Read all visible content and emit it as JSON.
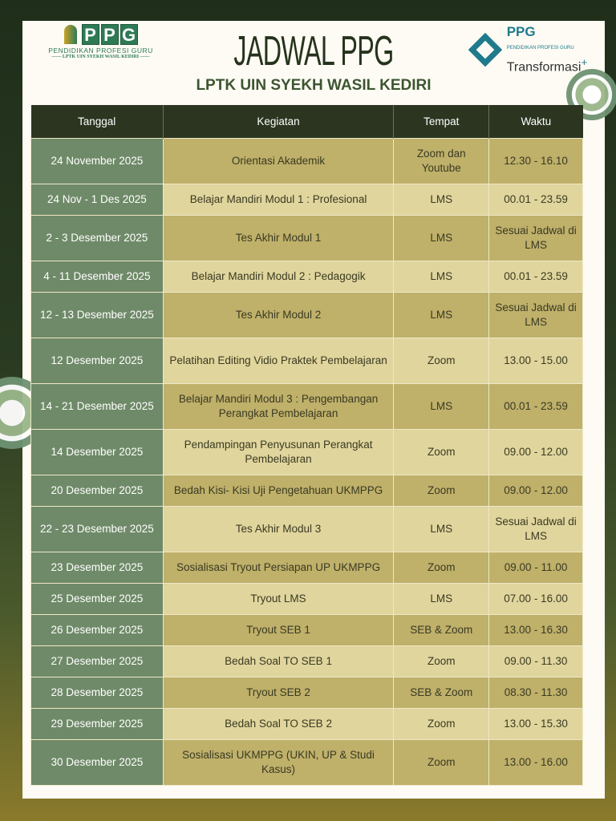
{
  "header": {
    "title": "JADWAL PPG",
    "subtitle": "LPTK UIN SYEKH WASIL KEDIRI",
    "logo_left": {
      "letters": [
        "P",
        "P",
        "G"
      ],
      "line1": "PENDIDIKAN PROFESI GURU",
      "line2": "—— LPTK UIN SYEKH WASIL KEDIRI ——"
    },
    "logo_right": {
      "brand": "PPG",
      "small": "PENDIDIKAN PROFESI GURU",
      "name": "Transformasi",
      "plus": "+"
    }
  },
  "table": {
    "columns": [
      "Tanggal",
      "Kegiatan",
      "Tempat",
      "Waktu"
    ],
    "rows": [
      {
        "tanggal": "24 November 2025",
        "kegiatan": "Orientasi Akademik",
        "tempat": "Zoom dan Youtube",
        "waktu": "12.30 - 16.10",
        "tall": true
      },
      {
        "tanggal": "24 Nov - 1 Des 2025",
        "kegiatan": "Belajar Mandiri Modul 1 : Profesional",
        "tempat": "LMS",
        "waktu": "00.01 - 23.59"
      },
      {
        "tanggal": "2 - 3 Desember 2025",
        "kegiatan": "Tes Akhir Modul 1",
        "tempat": "LMS",
        "waktu": "Sesuai Jadwal di LMS",
        "tall": true
      },
      {
        "tanggal": "4 - 11 Desember 2025",
        "kegiatan": "Belajar Mandiri Modul 2 : Pedagogik",
        "tempat": "LMS",
        "waktu": "00.01 - 23.59"
      },
      {
        "tanggal": "12 - 13 Desember 2025",
        "kegiatan": "Tes Akhir Modul 2",
        "tempat": "LMS",
        "waktu": "Sesuai Jadwal di LMS",
        "tall": true
      },
      {
        "tanggal": "12 Desember 2025",
        "kegiatan": "Pelatihan Editing Vidio Praktek Pembelajaran",
        "tempat": "Zoom",
        "waktu": "13.00 - 15.00",
        "tall": true
      },
      {
        "tanggal": "14 - 21 Desember 2025",
        "kegiatan": "Belajar Mandiri Modul 3 : Pengembangan Perangkat Pembelajaran",
        "tempat": "LMS",
        "waktu": "00.01 - 23.59",
        "tall": true
      },
      {
        "tanggal": "14 Desember 2025",
        "kegiatan": "Pendampingan Penyusunan Perangkat Pembelajaran",
        "tempat": "Zoom",
        "waktu": "09.00 - 12.00",
        "tall": true
      },
      {
        "tanggal": "20 Desember 2025",
        "kegiatan": "Bedah Kisi- Kisi Uji Pengetahuan UKMPPG",
        "tempat": "Zoom",
        "waktu": "09.00 - 12.00"
      },
      {
        "tanggal": "22 - 23 Desember 2025",
        "kegiatan": "Tes Akhir Modul 3",
        "tempat": "LMS",
        "waktu": "Sesuai Jadwal di LMS",
        "tall": true
      },
      {
        "tanggal": "23 Desember 2025",
        "kegiatan": "Sosialisasi Tryout Persiapan UP UKMPPG",
        "tempat": "Zoom",
        "waktu": "09.00 - 11.00"
      },
      {
        "tanggal": "25 Desember 2025",
        "kegiatan": "Tryout LMS",
        "tempat": "LMS",
        "waktu": "07.00 - 16.00"
      },
      {
        "tanggal": "26  Desember 2025",
        "kegiatan": "Tryout SEB 1",
        "tempat": "SEB & Zoom",
        "waktu": "13.00 - 16.30"
      },
      {
        "tanggal": "27 Desember 2025",
        "kegiatan": "Bedah Soal TO SEB 1",
        "tempat": "Zoom",
        "waktu": "09.00 - 11.30"
      },
      {
        "tanggal": "28 Desember 2025",
        "kegiatan": "Tryout SEB 2",
        "tempat": "SEB & Zoom",
        "waktu": "08.30 - 11.30"
      },
      {
        "tanggal": "29 Desember 2025",
        "kegiatan": "Bedah Soal TO SEB 2",
        "tempat": "Zoom",
        "waktu": "13.00 - 15.30"
      },
      {
        "tanggal": "30 Desember 2025",
        "kegiatan": "Sosialisasi UKMPPG (UKIN, UP & Studi Kasus)",
        "tempat": "Zoom",
        "waktu": "13.00 - 16.00",
        "tall": true
      }
    ]
  }
}
